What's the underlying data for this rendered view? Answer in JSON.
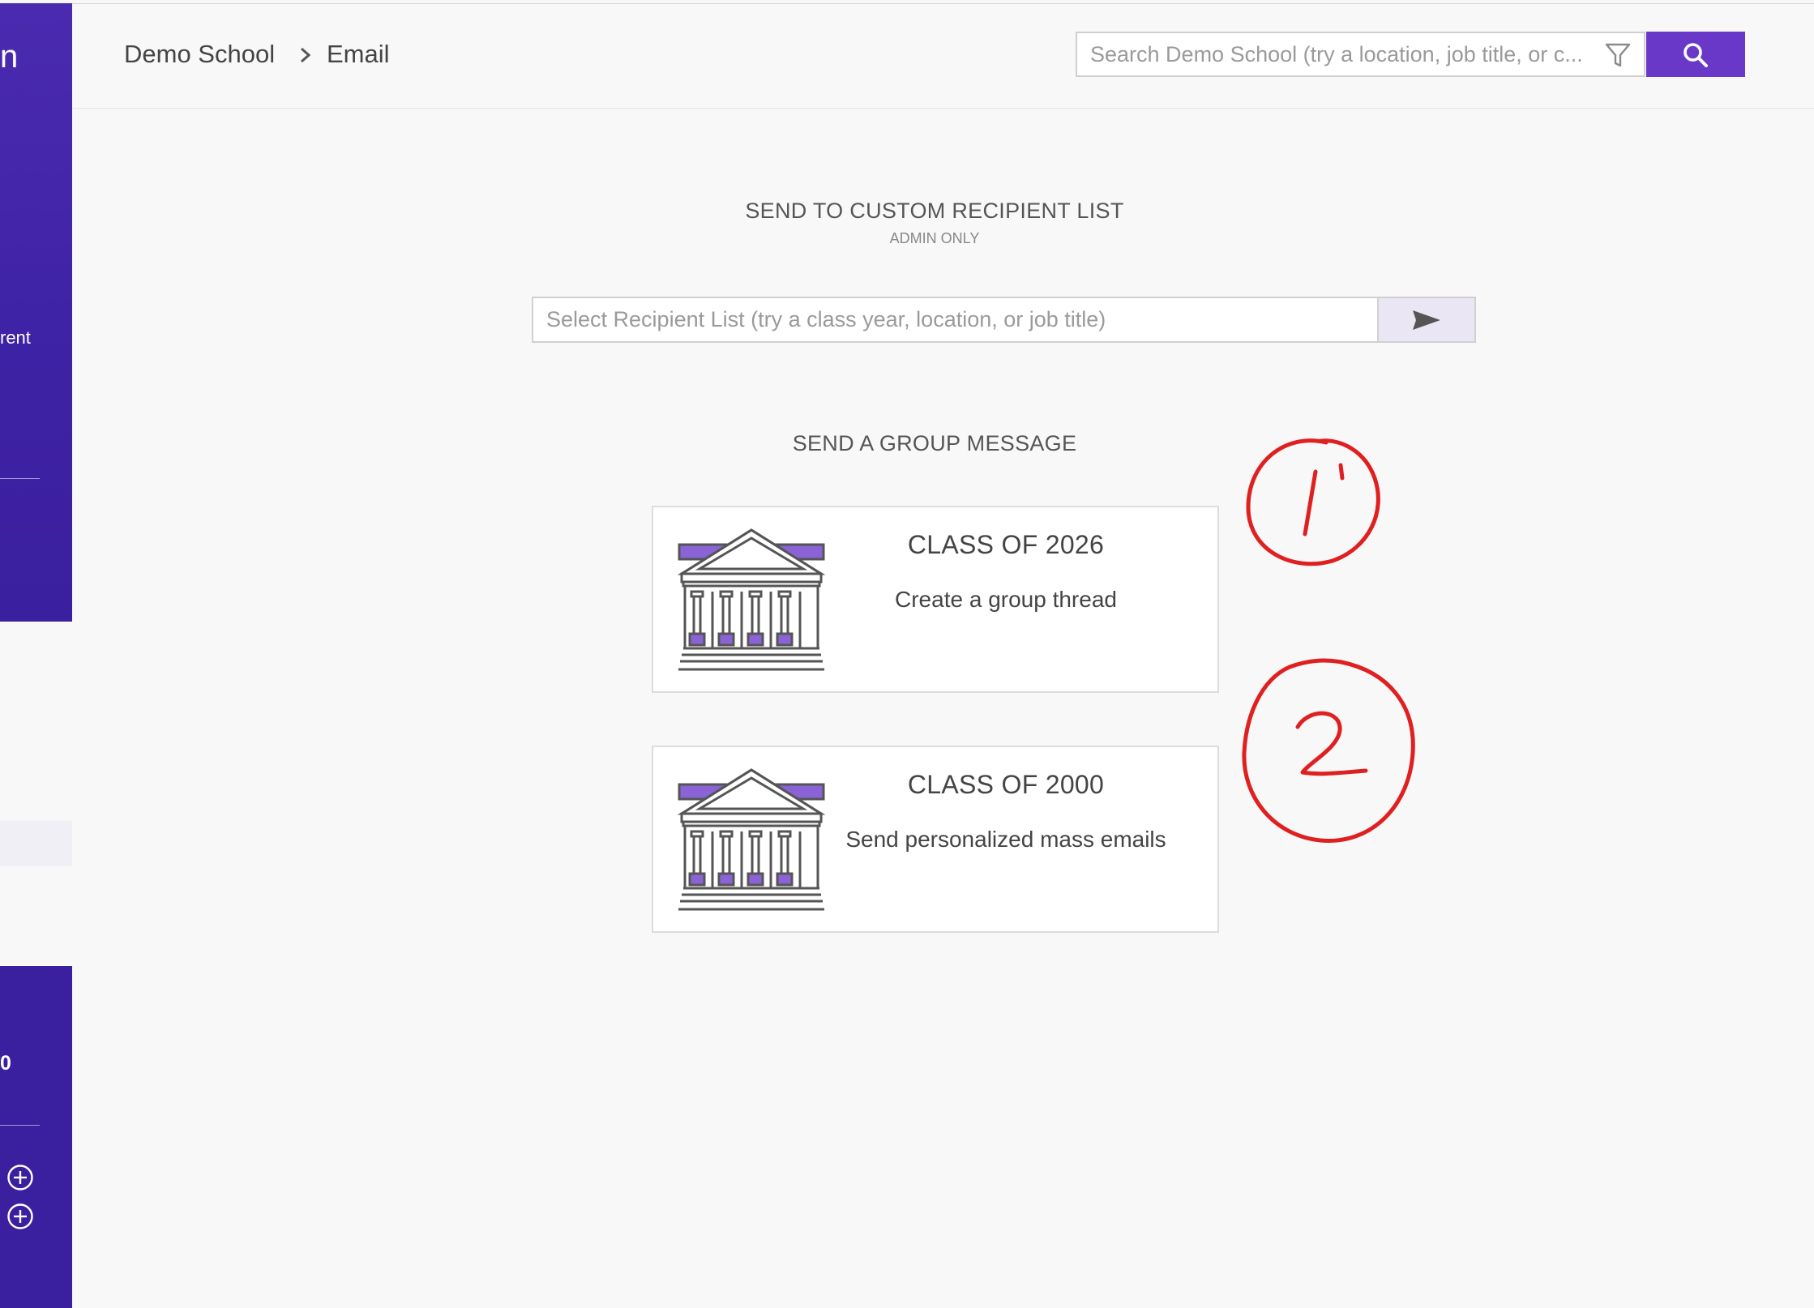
{
  "sidebar": {
    "partial_glyph": "n",
    "partial_text": "rent",
    "partial_count": "0",
    "plus_icons": [
      "plus-circle-icon",
      "plus-circle-icon"
    ]
  },
  "header": {
    "breadcrumb": [
      {
        "label": "Demo School"
      },
      {
        "label": "Email"
      }
    ],
    "search": {
      "placeholder": "Search Demo School (try a location, job title, or c...",
      "filter_icon": "filter-icon",
      "button_icon": "search-icon"
    }
  },
  "custom_list": {
    "title": "SEND TO CUSTOM RECIPIENT LIST",
    "subtitle": "ADMIN ONLY",
    "placeholder": "Select Recipient List (try a class year, location, or job title)",
    "send_icon": "send-icon"
  },
  "group": {
    "title": "SEND A GROUP MESSAGE",
    "cards": [
      {
        "title": "CLASS OF 2026",
        "description": "Create a group thread",
        "icon": "school-building-icon"
      },
      {
        "title": "CLASS OF 2000",
        "description": "Send personalized mass emails",
        "icon": "school-building-icon"
      }
    ]
  },
  "annotations": {
    "marks": [
      "1",
      "2"
    ],
    "color": "#e02020"
  },
  "colors": {
    "brand": "#6a38c9",
    "sidebar": "#3f23a6",
    "icon_purple": "#8a64d6",
    "send_bg": "#ebe6f4"
  }
}
